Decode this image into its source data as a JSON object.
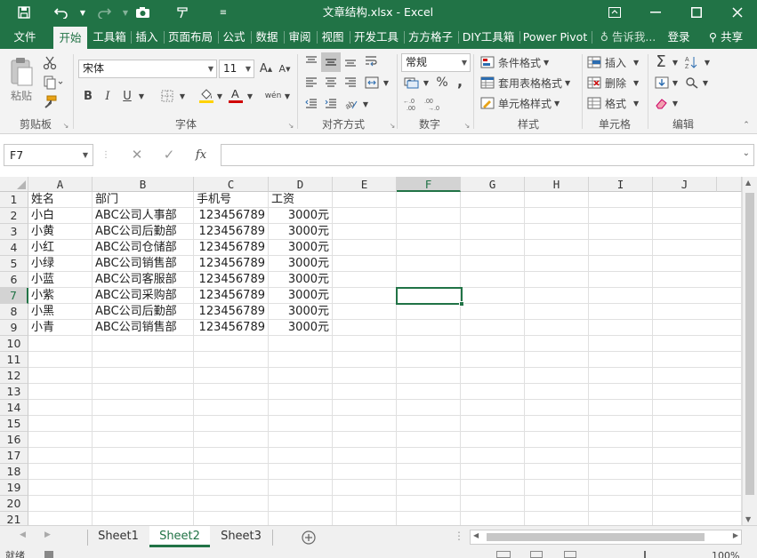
{
  "window": {
    "title": "文章结构.xlsx - Excel",
    "sign_in": "登录",
    "share": "共享",
    "tell_me": "告诉我..."
  },
  "tabs": [
    "文件",
    "开始",
    "工具箱",
    "插入",
    "页面布局",
    "公式",
    "数据",
    "审阅",
    "视图",
    "开发工具",
    "方方格子",
    "DIY工具箱",
    "Power Pivot"
  ],
  "active_tab": "开始",
  "ribbon": {
    "clipboard": {
      "label": "剪贴板",
      "paste": "粘贴"
    },
    "font": {
      "label": "字体",
      "font_name": "宋体",
      "font_size": "11",
      "bold": "B",
      "italic": "I",
      "underline": "U",
      "wen": "wén"
    },
    "alignment": {
      "label": "对齐方式"
    },
    "number": {
      "label": "数字",
      "format": "常规",
      "percent": "%",
      "comma": ","
    },
    "styles": {
      "label": "样式",
      "conditional": "条件格式",
      "table": "套用表格格式",
      "cell_style": "单元格样式"
    },
    "cells": {
      "label": "单元格",
      "insert": "插入",
      "delete": "删除",
      "format": "格式"
    },
    "editing": {
      "label": "编辑",
      "sum": "Σ"
    }
  },
  "formula_bar": {
    "name_box": "F7",
    "fx": "fx",
    "cancel": "✕",
    "enter": "✓",
    "value": ""
  },
  "columns": [
    "A",
    "B",
    "C",
    "D",
    "E",
    "F",
    "G",
    "H",
    "I",
    "J"
  ],
  "selected_column": "F",
  "selected_row": "7",
  "rows": [
    "1",
    "2",
    "3",
    "4",
    "5",
    "6",
    "7",
    "8",
    "9",
    "10",
    "11",
    "12",
    "13",
    "14",
    "15",
    "16",
    "17",
    "18",
    "19",
    "20",
    "21"
  ],
  "table": {
    "header": [
      "姓名",
      "部门",
      "手机号",
      "工资"
    ],
    "data": [
      [
        "小白",
        "ABC公司人事部",
        "123456789",
        "3000元"
      ],
      [
        "小黄",
        "ABC公司后勤部",
        "123456789",
        "3000元"
      ],
      [
        "小红",
        "ABC公司仓储部",
        "123456789",
        "3000元"
      ],
      [
        "小绿",
        "ABC公司销售部",
        "123456789",
        "3000元"
      ],
      [
        "小蓝",
        "ABC公司客服部",
        "123456789",
        "3000元"
      ],
      [
        "小紫",
        "ABC公司采购部",
        "123456789",
        "3000元"
      ],
      [
        "小黑",
        "ABC公司后勤部",
        "123456789",
        "3000元"
      ],
      [
        "小青",
        "ABC公司销售部",
        "123456789",
        "3000元"
      ]
    ]
  },
  "sheets": [
    "Sheet1",
    "Sheet2",
    "Sheet3"
  ],
  "active_sheet": "Sheet2",
  "status": {
    "ready": "就绪",
    "zoom": "100%"
  },
  "colors": {
    "accent": "#217346"
  }
}
